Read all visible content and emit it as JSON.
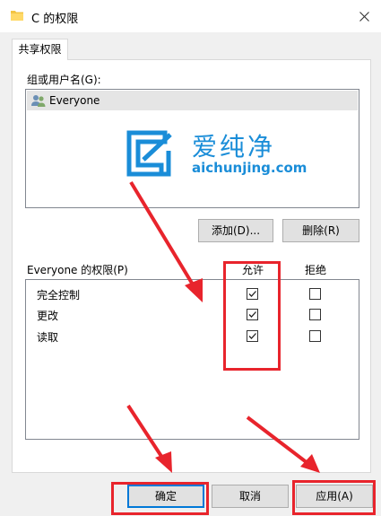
{
  "window": {
    "title": "C 的权限"
  },
  "tab": {
    "label": "共享权限"
  },
  "group": {
    "label": "组或用户名(G):",
    "users": [
      "Everyone"
    ]
  },
  "watermark": {
    "title": "爱纯净",
    "url": "aichunjing.com"
  },
  "buttons": {
    "add": "添加(D)...",
    "remove": "删除(R)",
    "ok": "确定",
    "cancel": "取消",
    "apply": "应用(A)"
  },
  "permissions": {
    "label": "Everyone 的权限(P)",
    "allow_header": "允许",
    "deny_header": "拒绝",
    "rows": [
      {
        "name": "完全控制",
        "allow": true,
        "deny": false
      },
      {
        "name": "更改",
        "allow": true,
        "deny": false
      },
      {
        "name": "读取",
        "allow": true,
        "deny": false
      }
    ]
  },
  "colors": {
    "annotation_red": "#e8242c",
    "accent_blue": "#0078d7",
    "watermark_blue": "#1a8dd8"
  }
}
